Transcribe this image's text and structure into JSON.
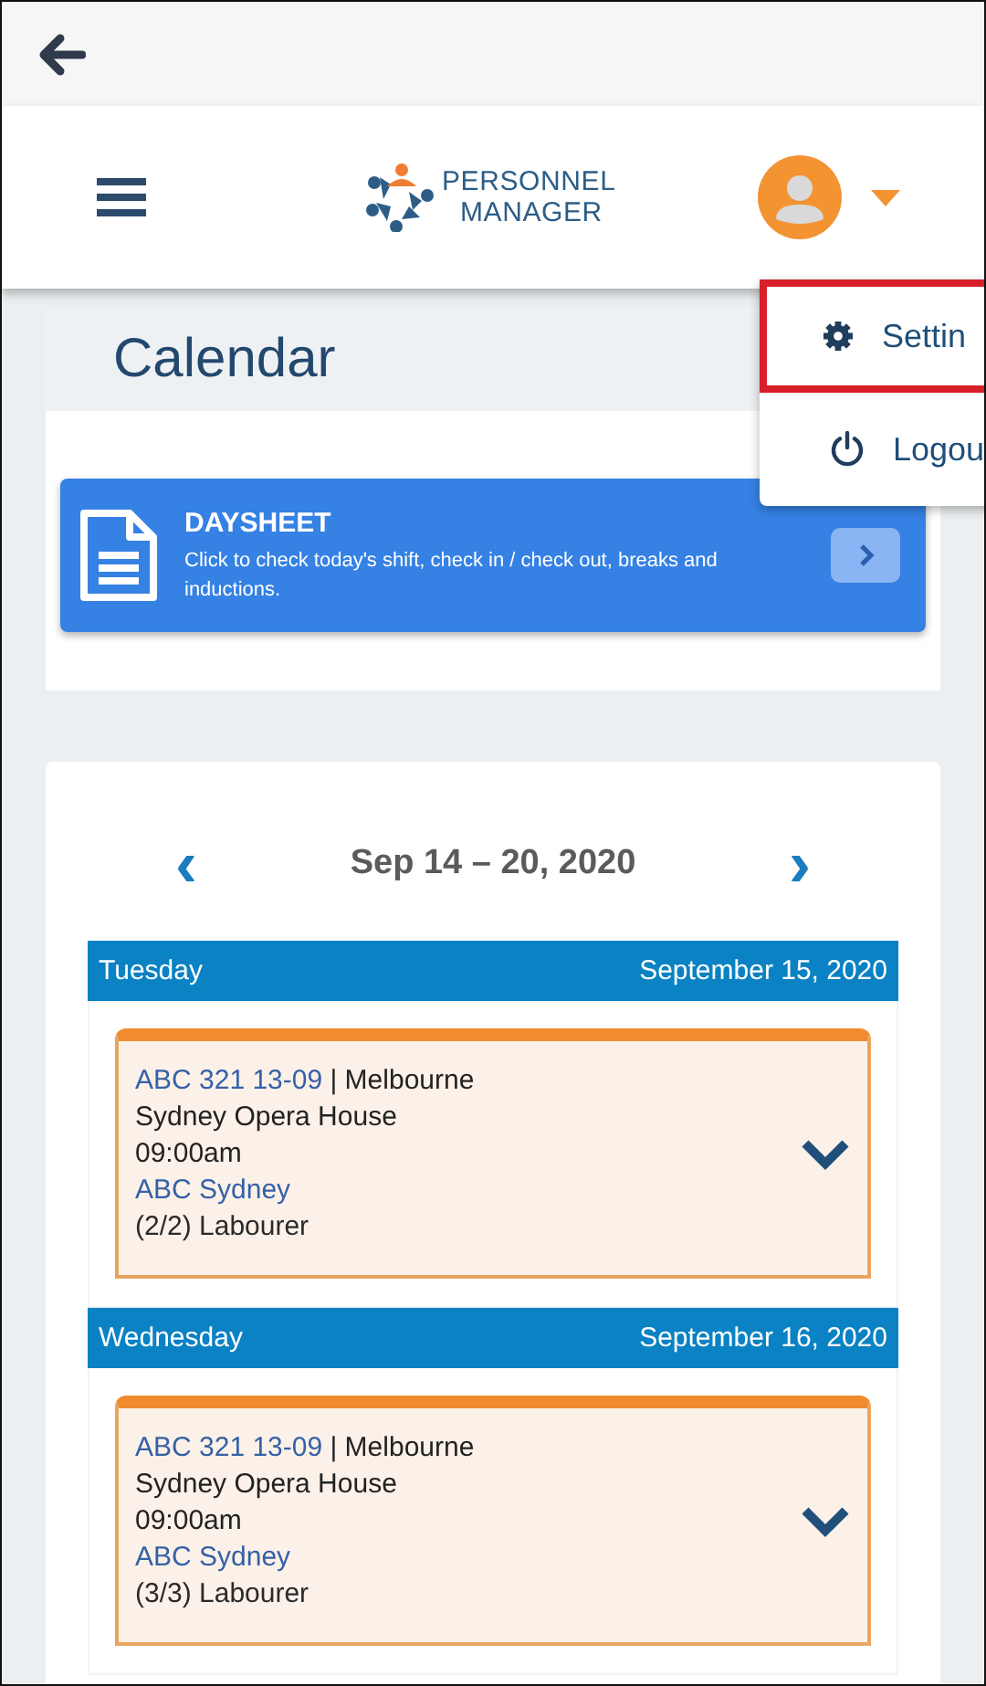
{
  "header": {
    "brand": [
      "PERSONNEL",
      "MANAGER"
    ]
  },
  "user_menu": {
    "items": [
      {
        "kind": "settings",
        "label": "Settin",
        "selected": true
      },
      {
        "kind": "logout",
        "label": "Logou",
        "selected": false
      }
    ]
  },
  "page": {
    "title": "Calendar"
  },
  "daysheet": {
    "title": "DAYSHEET",
    "description": "Click to check today's shift, check in / check out, breaks and inductions."
  },
  "week": {
    "range": "Sep 14 – 20, 2020",
    "prev": "‹",
    "next": "›"
  },
  "days": [
    {
      "weekday": "Tuesday",
      "date": "September 15, 2020",
      "shifts": [
        {
          "ref": "ABC 321 13-09",
          "separator": "|",
          "location": "Melbourne",
          "venue": "Sydney Opera House",
          "time": "09:00am",
          "client": "ABC Sydney",
          "role": "(2/2) Labourer"
        }
      ]
    },
    {
      "weekday": "Wednesday",
      "date": "September 16, 2020",
      "shifts": [
        {
          "ref": "ABC 321 13-09",
          "separator": "|",
          "location": "Melbourne",
          "venue": "Sydney Opera House",
          "time": "09:00am",
          "client": "ABC Sydney",
          "role": "(3/3) Labourer"
        }
      ]
    }
  ]
}
